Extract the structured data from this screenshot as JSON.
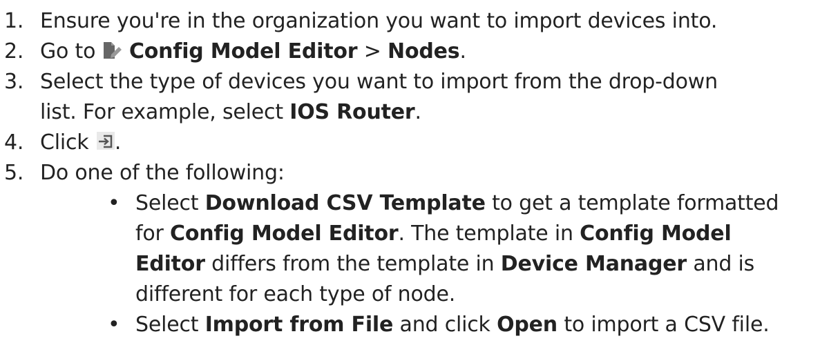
{
  "steps": [
    {
      "number": "1.",
      "text": "Ensure you're in the organization you want to import devices into."
    },
    {
      "number": "2.",
      "prefix": "Go to",
      "menu": "Config Model Editor",
      "separator": ">",
      "submenu": "Nodes",
      "suffix": "."
    },
    {
      "number": "3.",
      "line1": "Select the type of devices you want to import from the drop-down",
      "line2_prefix": "list. For example, select",
      "line2_bold": "IOS Router",
      "line2_suffix": "."
    },
    {
      "number": "4.",
      "prefix": "Click",
      "suffix": "."
    },
    {
      "number": "5.",
      "text": "Do one of the following:"
    }
  ],
  "bullets": [
    {
      "l1_a": "Select",
      "l1_b": "Download CSV Template",
      "l1_c": "to get a template formatted",
      "l2_a": "for",
      "l2_b": "Config Model Editor",
      "l2_c": ". The template in",
      "l2_d": "Config Model",
      "l3_a": "Editor",
      "l3_b": "differs from the template in",
      "l3_c": "Device Manager",
      "l3_d": "and is",
      "l4": "different for each type of node."
    },
    {
      "a": "Select",
      "b": "Import from File",
      "c": "and click",
      "d": "Open",
      "e": "to import a CSV file."
    }
  ],
  "bullet_symbol": "•",
  "icons": {
    "editor": "config-model-editor-icon",
    "import": "import-icon"
  },
  "colors": {
    "text": "#222222",
    "icon_dark": "#666666",
    "icon_light": "#999999",
    "icon_bg": "#e9e9e9"
  }
}
